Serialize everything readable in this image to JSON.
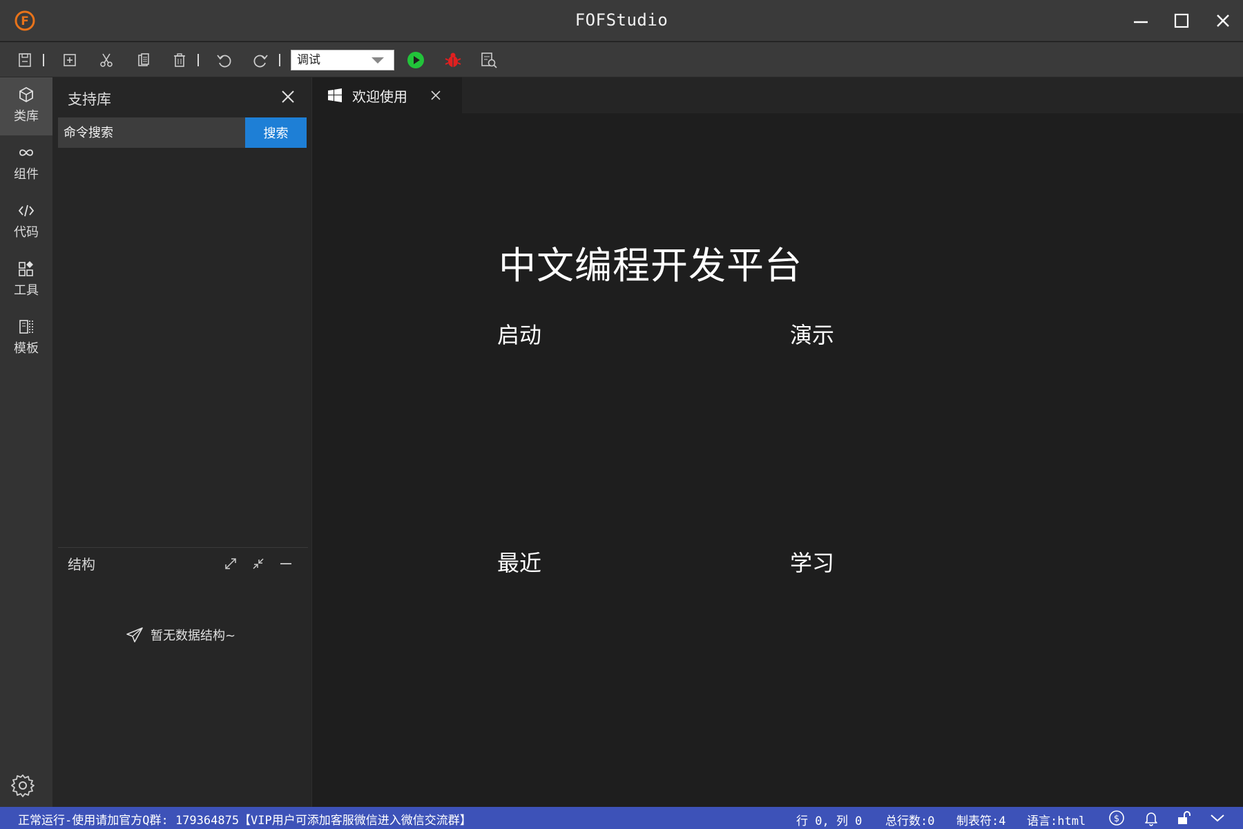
{
  "window": {
    "title": "FOFStudio",
    "logo_letter": "F"
  },
  "toolbar": {
    "mode_value": "调试"
  },
  "activity": {
    "items": [
      {
        "label": "类库"
      },
      {
        "label": "组件"
      },
      {
        "label": "代码"
      },
      {
        "label": "工具"
      },
      {
        "label": "模板"
      }
    ]
  },
  "sidebar": {
    "title": "支持库",
    "search_placeholder": "命令搜索",
    "search_button": "搜索",
    "structure_title": "结构",
    "empty_message": "暂无数据结构~"
  },
  "editor": {
    "tab_label": "欢迎使用",
    "heading": "中文编程开发平台",
    "sections": {
      "start": "启动",
      "demo": "演示",
      "recent": "最近",
      "learn": "学习"
    }
  },
  "statusbar": {
    "message": "正常运行-使用请加官方Q群: 179364875【VIP用户可添加客服微信进入微信交流群】",
    "position": "行 0, 列 0",
    "total_lines": "总行数:0",
    "tab_size": "制表符:4",
    "language": "语言:html"
  },
  "colors": {
    "accent_blue": "#1e7fd6",
    "status_bar": "#3d52b8",
    "run_green": "#22c33a",
    "debug_red": "#e02020",
    "logo_orange": "#e8731a"
  }
}
